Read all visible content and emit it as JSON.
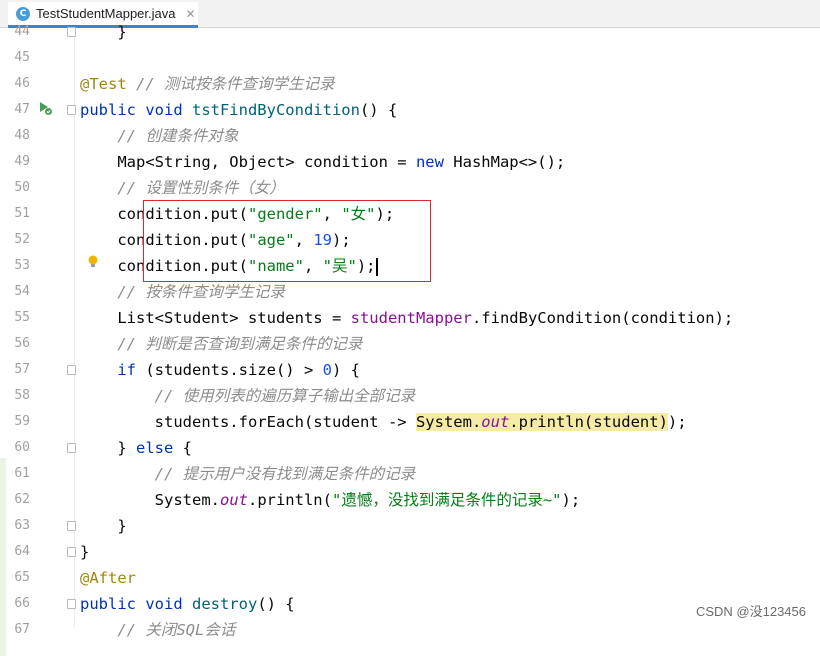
{
  "tab": {
    "title": "TestStudentMapper.java",
    "icon_letter": "C",
    "close": "✕"
  },
  "lines": [
    {
      "ln": "44",
      "tokens": [
        {
          "t": "    }",
          "c": ""
        }
      ]
    },
    {
      "ln": "45",
      "tokens": []
    },
    {
      "ln": "46",
      "tokens": [
        {
          "t": "@Test",
          "c": "a"
        },
        {
          "t": " ",
          "c": ""
        },
        {
          "t": "// 测试按条件查询学生记录",
          "c": "c"
        }
      ]
    },
    {
      "ln": "47",
      "tokens": [
        {
          "t": "public void ",
          "c": "k"
        },
        {
          "t": "tstFindByCondition",
          "c": "fn"
        },
        {
          "t": "() {",
          "c": ""
        }
      ]
    },
    {
      "ln": "48",
      "tokens": [
        {
          "t": "    // 创建条件对象",
          "c": "c"
        }
      ]
    },
    {
      "ln": "49",
      "tokens": [
        {
          "t": "    Map<String, Object> condition = ",
          "c": ""
        },
        {
          "t": "new ",
          "c": "k"
        },
        {
          "t": "HashMap<>();",
          "c": ""
        }
      ]
    },
    {
      "ln": "50",
      "tokens": [
        {
          "t": "    // 设置性别条件（女）",
          "c": "c"
        }
      ]
    },
    {
      "ln": "51",
      "tokens": [
        {
          "t": "    condition.put(",
          "c": ""
        },
        {
          "t": "\"gender\"",
          "c": "s"
        },
        {
          "t": ", ",
          "c": ""
        },
        {
          "t": "\"女\"",
          "c": "s"
        },
        {
          "t": ");",
          "c": ""
        }
      ]
    },
    {
      "ln": "52",
      "tokens": [
        {
          "t": "    condition.put(",
          "c": ""
        },
        {
          "t": "\"age\"",
          "c": "s"
        },
        {
          "t": ", ",
          "c": ""
        },
        {
          "t": "19",
          "c": "n"
        },
        {
          "t": ");",
          "c": ""
        }
      ]
    },
    {
      "ln": "53",
      "tokens": [
        {
          "t": "    condition.put(",
          "c": ""
        },
        {
          "t": "\"name\"",
          "c": "s"
        },
        {
          "t": ", ",
          "c": ""
        },
        {
          "t": "\"吴\"",
          "c": "s"
        },
        {
          "t": ");",
          "c": ""
        }
      ]
    },
    {
      "ln": "54",
      "tokens": [
        {
          "t": "    // 按条件查询学生记录",
          "c": "c"
        }
      ]
    },
    {
      "ln": "55",
      "tokens": [
        {
          "t": "    List<Student> students = ",
          "c": ""
        },
        {
          "t": "studentMapper",
          "c": "fld"
        },
        {
          "t": ".findByCondition(condition);",
          "c": ""
        }
      ]
    },
    {
      "ln": "56",
      "tokens": [
        {
          "t": "    // 判断是否查询到满足条件的记录",
          "c": "c"
        }
      ]
    },
    {
      "ln": "57",
      "tokens": [
        {
          "t": "    ",
          "c": ""
        },
        {
          "t": "if ",
          "c": "k"
        },
        {
          "t": "(students.size() > ",
          "c": ""
        },
        {
          "t": "0",
          "c": "n"
        },
        {
          "t": ") {",
          "c": ""
        }
      ]
    },
    {
      "ln": "58",
      "tokens": [
        {
          "t": "        // 使用列表的遍历算子输出全部记录",
          "c": "c"
        }
      ]
    },
    {
      "ln": "59",
      "tokens": [
        {
          "t": "        students.forEach(student -> ",
          "c": ""
        },
        {
          "t": "System.",
          "c": "hl"
        },
        {
          "t": "out",
          "c": "st hl"
        },
        {
          "t": ".println(student)",
          "c": "hl"
        },
        {
          "t": ");",
          "c": ""
        }
      ]
    },
    {
      "ln": "60",
      "tokens": [
        {
          "t": "    } ",
          "c": ""
        },
        {
          "t": "else ",
          "c": "k"
        },
        {
          "t": "{",
          "c": ""
        }
      ]
    },
    {
      "ln": "61",
      "tokens": [
        {
          "t": "        // 提示用户没有找到满足条件的记录",
          "c": "c"
        }
      ]
    },
    {
      "ln": "62",
      "tokens": [
        {
          "t": "        System.",
          "c": ""
        },
        {
          "t": "out",
          "c": "st"
        },
        {
          "t": ".println(",
          "c": ""
        },
        {
          "t": "\"遗憾，没找到满足条件的记录~\"",
          "c": "s"
        },
        {
          "t": ");",
          "c": ""
        }
      ]
    },
    {
      "ln": "63",
      "tokens": [
        {
          "t": "    }",
          "c": ""
        }
      ]
    },
    {
      "ln": "64",
      "tokens": [
        {
          "t": "}",
          "c": ""
        }
      ]
    },
    {
      "ln": "65",
      "tokens": [
        {
          "t": "@After",
          "c": "a"
        }
      ]
    },
    {
      "ln": "66",
      "tokens": [
        {
          "t": "public void ",
          "c": "k"
        },
        {
          "t": "destroy",
          "c": "fn"
        },
        {
          "t": "() {",
          "c": ""
        }
      ]
    },
    {
      "ln": "67",
      "tokens": [
        {
          "t": "    // 关闭SQL会话",
          "c": "c"
        }
      ]
    }
  ],
  "fold_lines": [
    "44",
    "47",
    "57",
    "60",
    "63",
    "64",
    "66"
  ],
  "caret_line": "53",
  "watermark": "CSDN @没123456",
  "colors": {
    "keyword": "#0033b3",
    "string": "#067d17",
    "number": "#1750eb",
    "comment": "#8c8c8c",
    "annotation": "#9e880d",
    "highlight_box": "#d9272b"
  }
}
